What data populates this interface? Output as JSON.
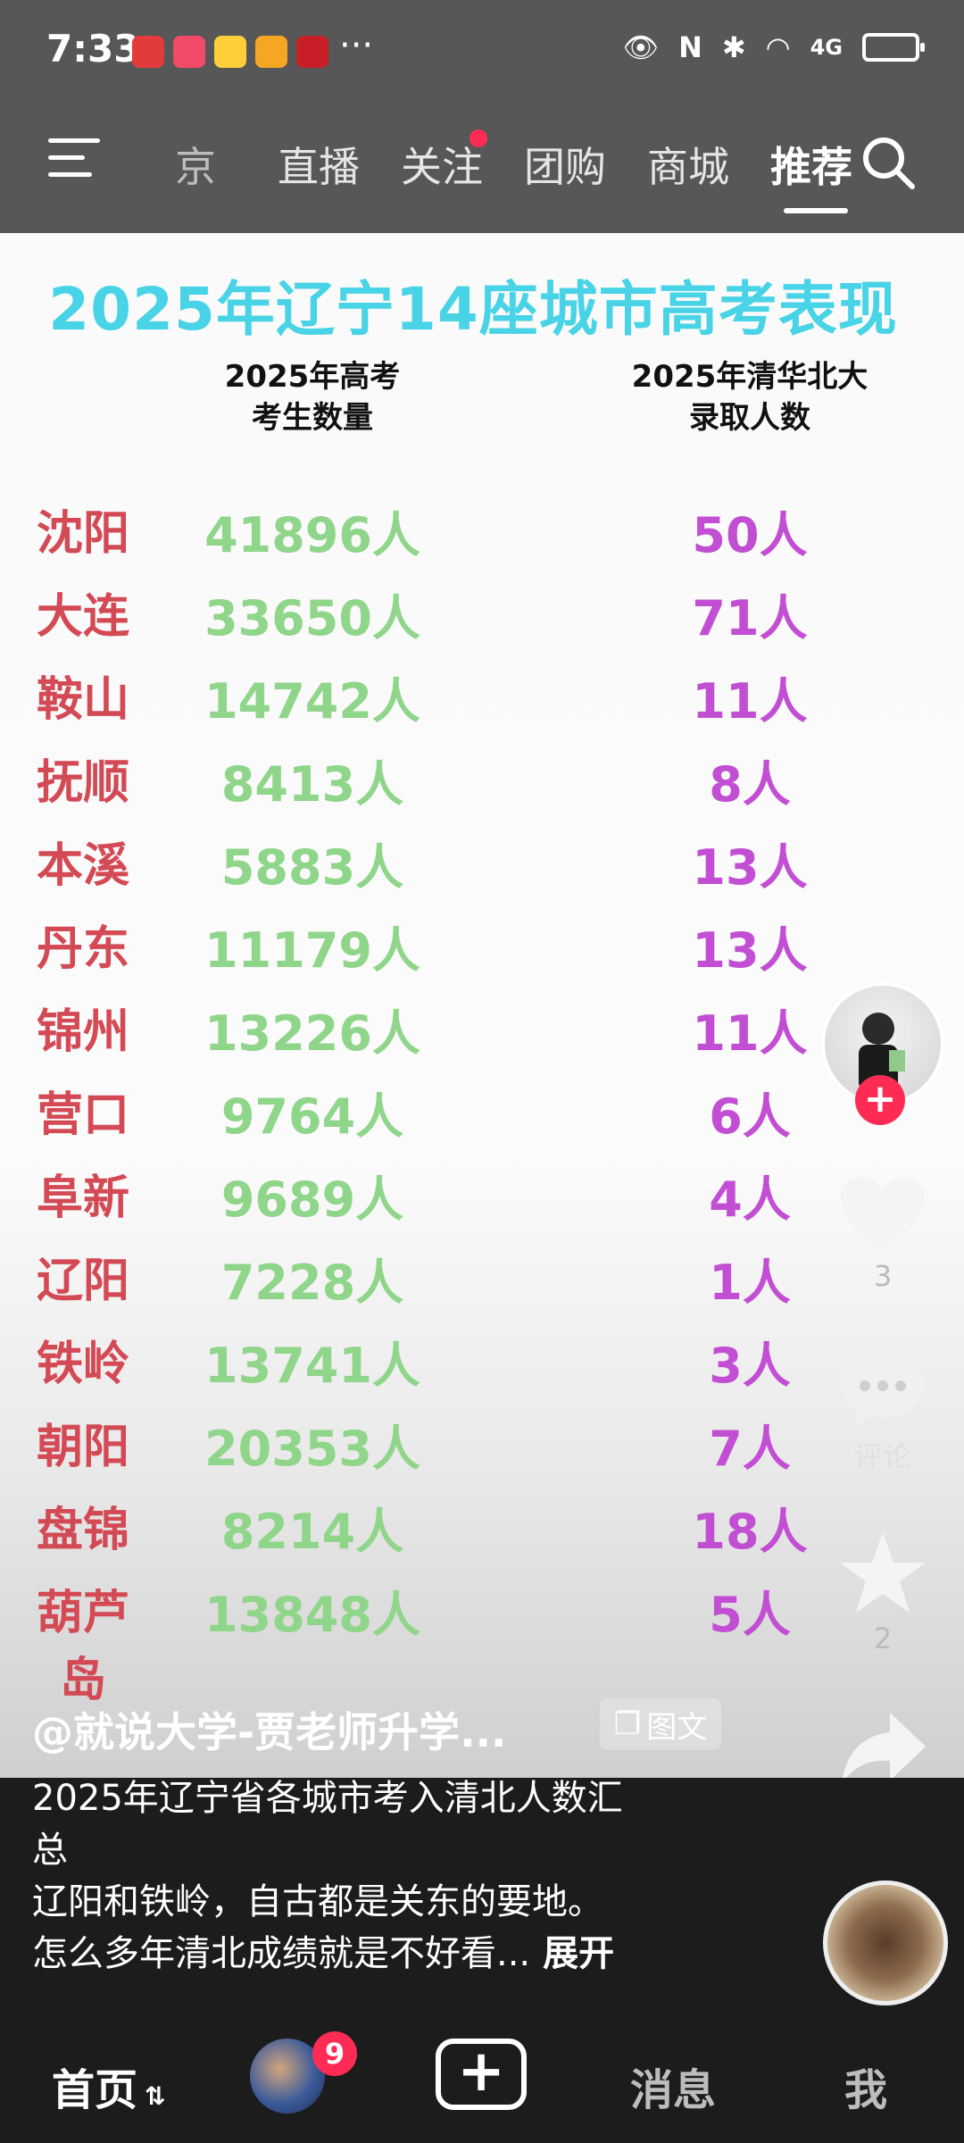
{
  "status": {
    "time": "7:33",
    "network": "4G"
  },
  "nav": {
    "tabs": [
      "京",
      "直播",
      "关注",
      "团购",
      "商城",
      "推荐"
    ],
    "active_tab": "推荐"
  },
  "poster": {
    "title": "2025年辽宁14座城市高考表现",
    "col_exam": "2025年高考\n考生数量",
    "col_admit": "2025年清华北大\n录取人数",
    "rows": [
      {
        "city": "沈阳",
        "exam": "41896人",
        "admit": "50人"
      },
      {
        "city": "大连",
        "exam": "33650人",
        "admit": "71人"
      },
      {
        "city": "鞍山",
        "exam": "14742人",
        "admit": "11人"
      },
      {
        "city": "抚顺",
        "exam": "8413人",
        "admit": "8人"
      },
      {
        "city": "本溪",
        "exam": "5883人",
        "admit": "13人"
      },
      {
        "city": "丹东",
        "exam": "11179人",
        "admit": "13人"
      },
      {
        "city": "锦州",
        "exam": "13226人",
        "admit": "11人"
      },
      {
        "city": "营口",
        "exam": "9764人",
        "admit": "6人"
      },
      {
        "city": "阜新",
        "exam": "9689人",
        "admit": "4人"
      },
      {
        "city": "辽阳",
        "exam": "7228人",
        "admit": "1人"
      },
      {
        "city": "铁岭",
        "exam": "13741人",
        "admit": "3人"
      },
      {
        "city": "朝阳",
        "exam": "20353人",
        "admit": "7人"
      },
      {
        "city": "盘锦",
        "exam": "8214人",
        "admit": "18人"
      },
      {
        "city": "葫芦岛",
        "exam": "13848人",
        "admit": "5人"
      }
    ]
  },
  "side": {
    "likes": "3",
    "comments_label": "评论",
    "favorites": "2",
    "share_label": "分享"
  },
  "post": {
    "author": "@就说大学-贾老师升学...",
    "badge": "图文",
    "line1": "2025年辽宁省各城市考入清北人数汇",
    "line2": "总",
    "line3": "辽阳和铁岭，自古都是关东的要地。",
    "line4": "怎么多年清北成绩就是不好看...",
    "expand": "展开"
  },
  "bottom": {
    "home": "首页",
    "friends_badge": "9",
    "messages": "消息",
    "me": "我"
  },
  "colors": {
    "accent": "#fe2c55",
    "title": "#48d3e6",
    "city": "#d34a55",
    "exam": "#8fd58a",
    "admit": "#c24fd3"
  }
}
